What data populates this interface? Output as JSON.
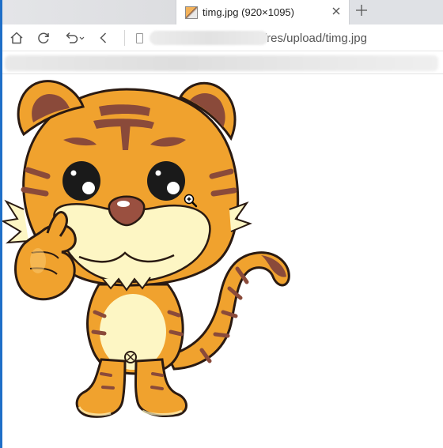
{
  "tab": {
    "title": "timg.jpg (920×1095)",
    "close_icon": "close-icon",
    "new_tab_icon": "plus-icon"
  },
  "navbar": {
    "home_icon": "home-icon",
    "reload_icon": "reload-icon",
    "undo_icon": "undo-icon",
    "back_icon": "back-icon",
    "url_visible": "/res/upload/timg.jpg"
  },
  "content": {
    "image_subject": "cartoon tiger",
    "cursor_icon": "zoom-in-icon"
  },
  "colors": {
    "accent_blue": "#1f6fc8",
    "tiger_orange": "#f0a22e",
    "tiger_stripe": "#8a4a3a",
    "tiger_cream": "#fdf6c4"
  }
}
